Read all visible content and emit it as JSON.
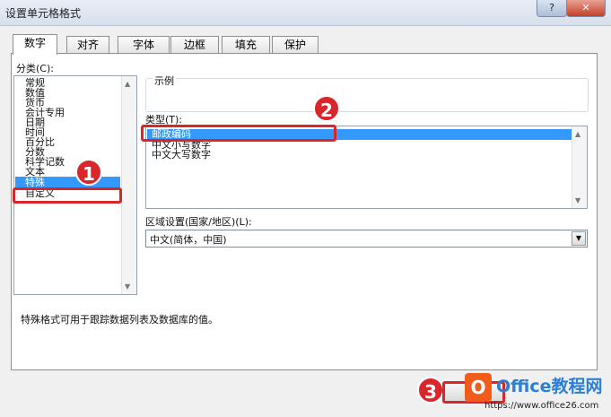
{
  "window": {
    "title": "设置单元格格式",
    "help_label": "?",
    "close_label": "✕"
  },
  "tabs": [
    {
      "label": "数字",
      "active": true
    },
    {
      "label": "对齐",
      "active": false
    },
    {
      "label": "字体",
      "active": false
    },
    {
      "label": "边框",
      "active": false
    },
    {
      "label": "填充",
      "active": false
    },
    {
      "label": "保护",
      "active": false
    }
  ],
  "category": {
    "label": "分类(C):",
    "items": [
      "常规",
      "数值",
      "货币",
      "会计专用",
      "日期",
      "时间",
      "百分比",
      "分数",
      "科学记数",
      "文本",
      "特殊",
      "自定义"
    ],
    "selected_index": 10
  },
  "sample": {
    "label": "示例"
  },
  "type_section": {
    "label": "类型(T):",
    "items": [
      "邮政编码",
      "中文小写数字",
      "中文大写数字"
    ],
    "selected_index": 0
  },
  "locale": {
    "label": "区域设置(国家/地区)(L):",
    "value": "中文(简体，中国)"
  },
  "description": "特殊格式可用于跟踪数据列表及数据库的值。",
  "annotations": [
    {
      "number": "1",
      "color": "#d8262b"
    },
    {
      "number": "2",
      "color": "#d8262b"
    },
    {
      "number": "3",
      "color": "#d8262b"
    }
  ],
  "watermark": {
    "logo_text": "O",
    "title": "Office教程网",
    "url": "https://www.office26.com"
  },
  "colors": {
    "accent": "#3399ff",
    "annotation": "#d8262b",
    "logo": "#f25c1a"
  }
}
